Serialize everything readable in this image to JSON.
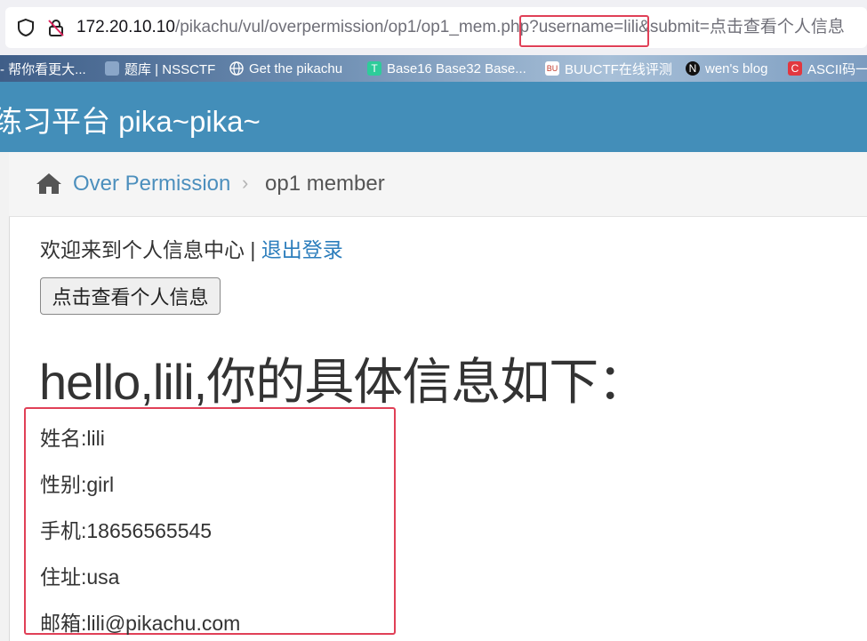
{
  "browser": {
    "url_host": "172.20.10.10",
    "url_path": "/pikachu/vul/overpermission/op1/op1_mem.php",
    "url_query_highlight": "?username=lili&",
    "url_query_rest": "submit=点击查看个人信息",
    "icons": [
      "shield-icon",
      "insecure-lock-icon"
    ]
  },
  "bookmarks": [
    {
      "label": "- 帮你看更大...",
      "icon": "none",
      "color": ""
    },
    {
      "label": "题库 | NSSCTF",
      "icon": "nssctf-icon",
      "color": "#8aa6c8"
    },
    {
      "label": "Get the pikachu",
      "icon": "globe-icon",
      "color": ""
    },
    {
      "label": "Base16 Base32 Base...",
      "icon": "t-icon",
      "color": "#2ecc9a"
    },
    {
      "label": "BUUCTF在线评测",
      "icon": "buuctf-icon",
      "color": "#c0392b"
    },
    {
      "label": "wen's blog",
      "icon": "n-icon",
      "color": "#111111"
    },
    {
      "label": "ASCII码一",
      "icon": "c-icon",
      "color": "#e2373f"
    }
  ],
  "navbar": {
    "brand": "练习平台 pika~pika~"
  },
  "breadcrumb": {
    "link": "Over Permission",
    "separator": "›",
    "current": "op1 member"
  },
  "main": {
    "welcome_text": "欢迎来到个人信息中心",
    "divider": "|",
    "logout_label": "退出登录",
    "view_button": "点击查看个人信息",
    "hello": "hello,lili,你的具体信息如下：",
    "info": [
      {
        "label": "姓名:",
        "value": "lili"
      },
      {
        "label": "性别:",
        "value": "girl"
      },
      {
        "label": "手机:",
        "value": "18656565545"
      },
      {
        "label": "住址:",
        "value": "usa"
      },
      {
        "label": "邮箱:",
        "value": "lili@pikachu.com"
      }
    ]
  },
  "colors": {
    "navbar": "#438eb9",
    "link": "#4c8fbd",
    "highlight": "#e04057"
  }
}
